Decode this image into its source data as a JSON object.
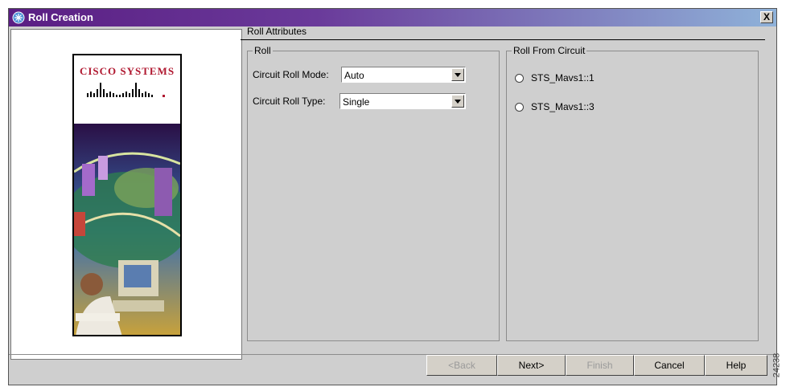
{
  "window": {
    "title": "Roll Creation",
    "close_label": "X"
  },
  "brand": {
    "name": "Cisco Systems",
    "text": "CISCO SYSTEMS"
  },
  "tab": {
    "label": "Roll Attributes"
  },
  "roll_group": {
    "label": "Roll",
    "mode_label": "Circuit Roll Mode:",
    "mode_value": "Auto",
    "type_label": "Circuit Roll Type:",
    "type_value": "Single"
  },
  "from_group": {
    "label": "Roll From Circuit",
    "options": [
      {
        "label": "STS_Mavs1::1",
        "selected": false
      },
      {
        "label": "STS_Mavs1::3",
        "selected": false
      }
    ]
  },
  "buttons": {
    "back": "<Back",
    "next": "Next>",
    "finish": "Finish",
    "cancel": "Cancel",
    "help": "Help"
  },
  "watermark": "24238",
  "colors": {
    "titlebar_start": "#5a1e83",
    "titlebar_end": "#8fb2d9",
    "dialog_bg": "#cfcfcf",
    "brand_red": "#b01830"
  }
}
